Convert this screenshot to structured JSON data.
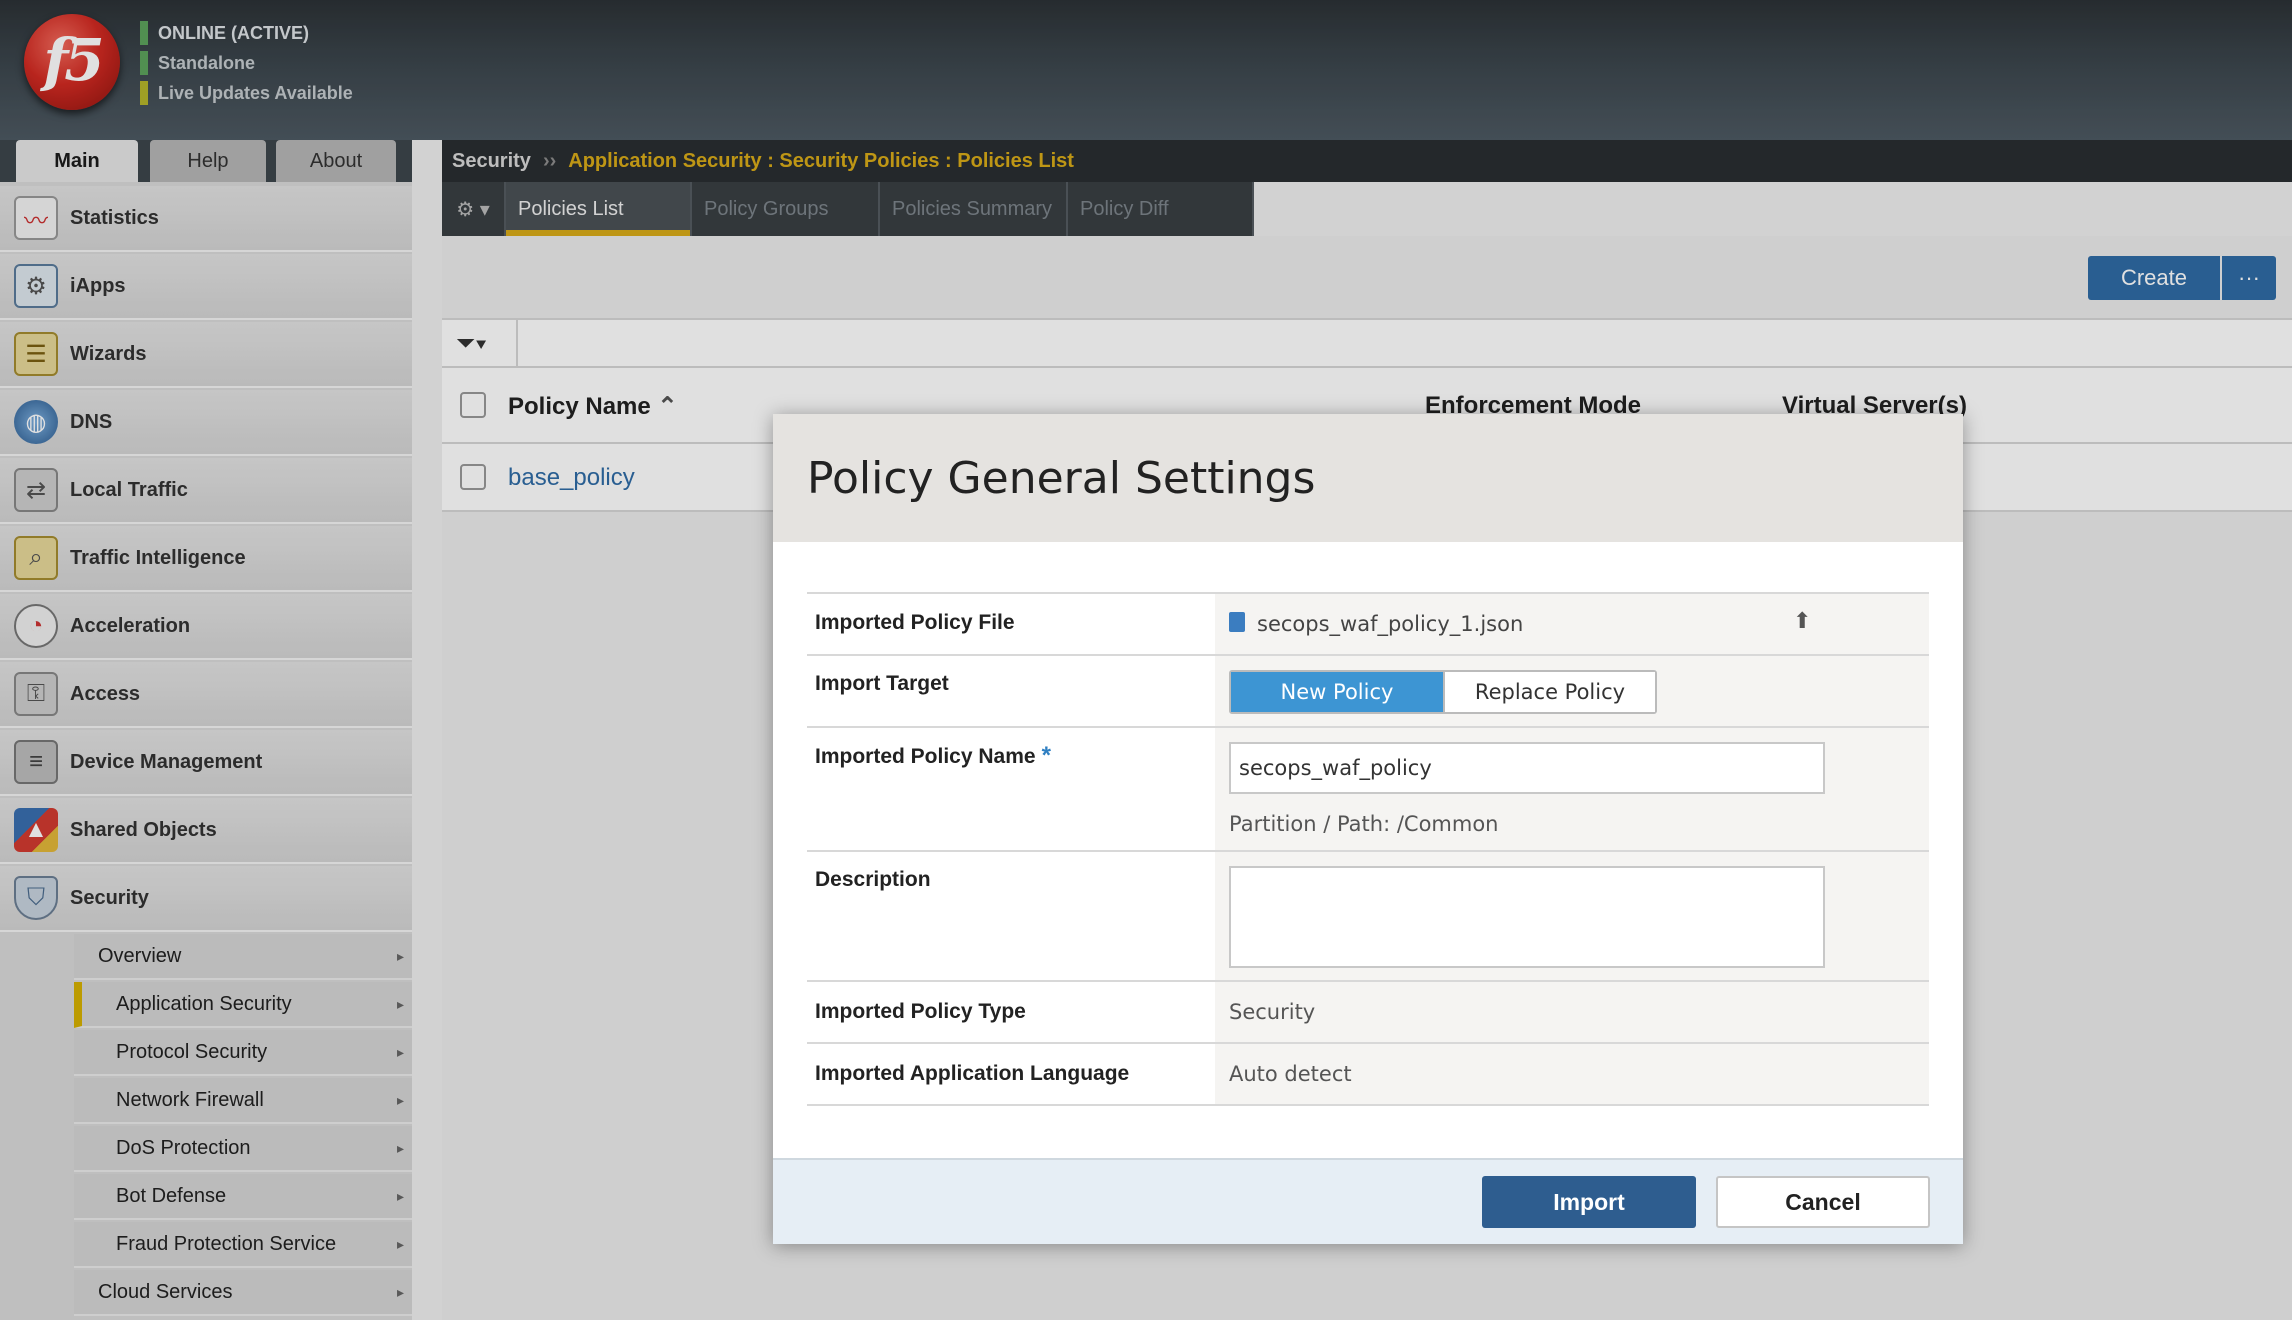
{
  "header": {
    "logo_text": "f5",
    "status": [
      {
        "text": "ONLINE (ACTIVE)",
        "color": "#5da35d"
      },
      {
        "text": "Standalone",
        "color": "#5da35d"
      },
      {
        "text": "Live Updates Available",
        "color": "#b5b52b"
      }
    ]
  },
  "nav_tabs": {
    "main": "Main",
    "help": "Help",
    "about": "About"
  },
  "sidebar": {
    "items": [
      {
        "label": "Statistics",
        "icon": "statistics-icon"
      },
      {
        "label": "iApps",
        "icon": "iapps-icon"
      },
      {
        "label": "Wizards",
        "icon": "wizards-icon"
      },
      {
        "label": "DNS",
        "icon": "dns-globe-icon"
      },
      {
        "label": "Local Traffic",
        "icon": "local-traffic-icon"
      },
      {
        "label": "Traffic Intelligence",
        "icon": "traffic-intelligence-icon"
      },
      {
        "label": "Acceleration",
        "icon": "acceleration-gauge-icon"
      },
      {
        "label": "Access",
        "icon": "access-icon"
      },
      {
        "label": "Device Management",
        "icon": "device-management-icon"
      },
      {
        "label": "Shared Objects",
        "icon": "shared-objects-icon"
      },
      {
        "label": "Security",
        "icon": "security-shield-icon"
      }
    ],
    "security_sub": [
      {
        "label": "Overview",
        "indent": false,
        "active": false
      },
      {
        "label": "Application Security",
        "indent": true,
        "active": true
      },
      {
        "label": "Protocol Security",
        "indent": true,
        "active": false
      },
      {
        "label": "Network Firewall",
        "indent": true,
        "active": false
      },
      {
        "label": "DoS Protection",
        "indent": true,
        "active": false
      },
      {
        "label": "Bot Defense",
        "indent": true,
        "active": false
      },
      {
        "label": "Fraud Protection Service",
        "indent": true,
        "active": false
      },
      {
        "label": "Cloud Services",
        "indent": false,
        "active": false
      }
    ],
    "accent_color": "#d7b100"
  },
  "breadcrumb": {
    "root": "Security",
    "separator": "››",
    "path": "Application Security : Security Policies : Policies List"
  },
  "subtabs": [
    "Policies List",
    "Policy Groups",
    "Policies Summary",
    "Policy Diff"
  ],
  "toolbar": {
    "create_label": "Create",
    "more_label": "···"
  },
  "table": {
    "columns": {
      "name": "Policy Name",
      "enforcement": "Enforcement Mode",
      "virtual_servers": "Virtual Server(s)"
    },
    "rows": [
      {
        "name": "base_policy"
      }
    ]
  },
  "modal": {
    "title": "Policy General Settings",
    "fields": {
      "file_label": "Imported Policy File",
      "file_name": "secops_waf_policy_1.json",
      "target_label": "Import Target",
      "target_options": [
        "New Policy",
        "Replace Policy"
      ],
      "target_selected": "New Policy",
      "name_label": "Imported Policy Name",
      "name_required_mark": "*",
      "name_value": "secops_waf_policy",
      "partition_hint": "Partition / Path: /Common",
      "description_label": "Description",
      "description_value": "",
      "type_label": "Imported Policy Type",
      "type_value": "Security",
      "language_label": "Imported Application Language",
      "language_value": "Auto detect"
    },
    "buttons": {
      "import": "Import",
      "cancel": "Cancel"
    }
  }
}
